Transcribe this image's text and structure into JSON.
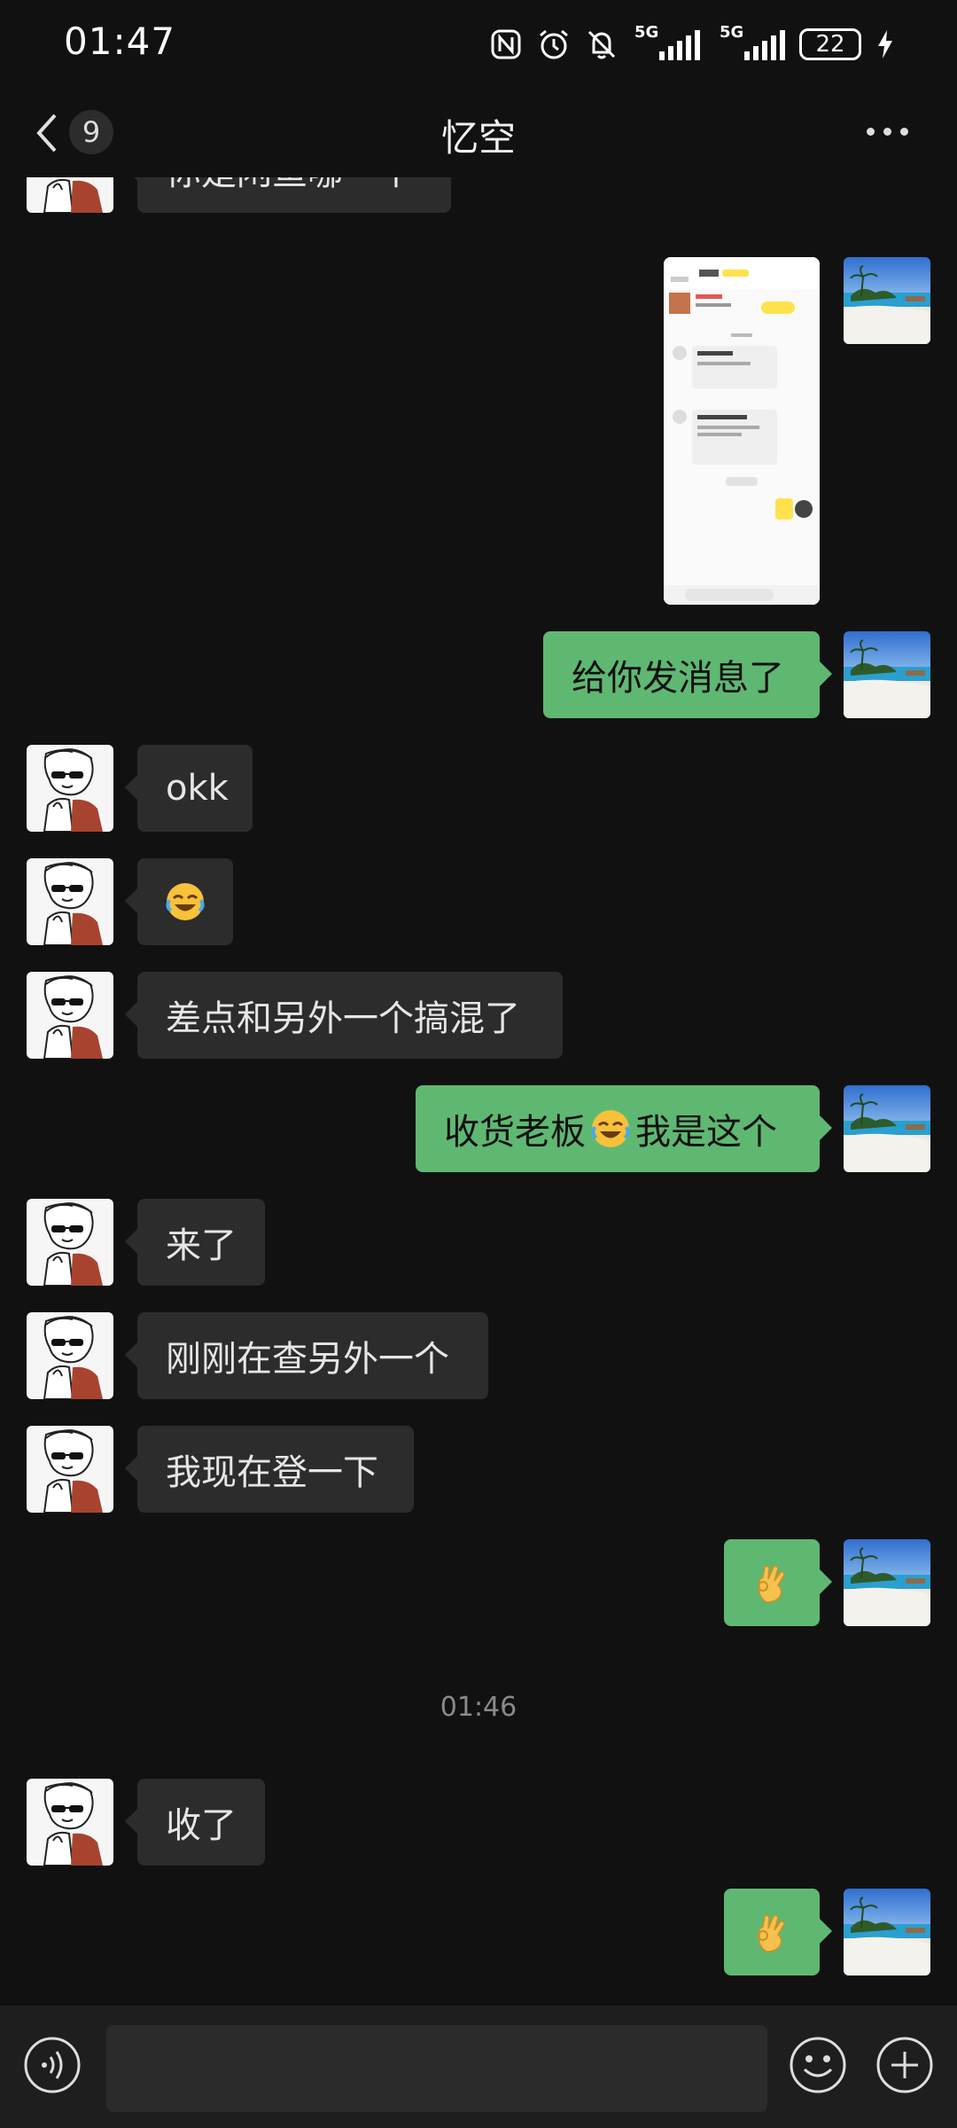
{
  "status_bar": {
    "time": "01:47",
    "nfc_icon": "nfc-icon",
    "alarm_icon": "alarm-icon",
    "mute_icon": "bell-off-icon",
    "signal1_label": "5G",
    "signal2_label": "5G",
    "battery": "22",
    "charging_icon": "bolt-icon"
  },
  "header": {
    "back_icon": "chevron-left-icon",
    "unread_count": "9",
    "title": "忆空",
    "more_icon": "more-dots-icon"
  },
  "messages": {
    "m0": "你是闲鱼哪一个",
    "m2": "给你发消息了",
    "m3": "okk",
    "m5": "差点和另外一个搞混了",
    "m6a": "收货老板",
    "m6b": "我是这个",
    "m7": "来了",
    "m8": "刚刚在查另外一个",
    "m9": "我现在登一下",
    "timestamp": "01:46",
    "m11": "收了"
  },
  "emoji": {
    "laugh_cry": "laugh-cry-emoji",
    "ok_hand": "ok-hand-emoji"
  },
  "bottom_bar": {
    "voice_icon": "voice-icon",
    "emoji_icon": "smile-icon",
    "plus_icon": "plus-icon",
    "input_value": ""
  },
  "colors": {
    "background": "#111111",
    "incoming_bubble": "#2c2c2c",
    "outgoing_bubble": "#5fb872"
  }
}
